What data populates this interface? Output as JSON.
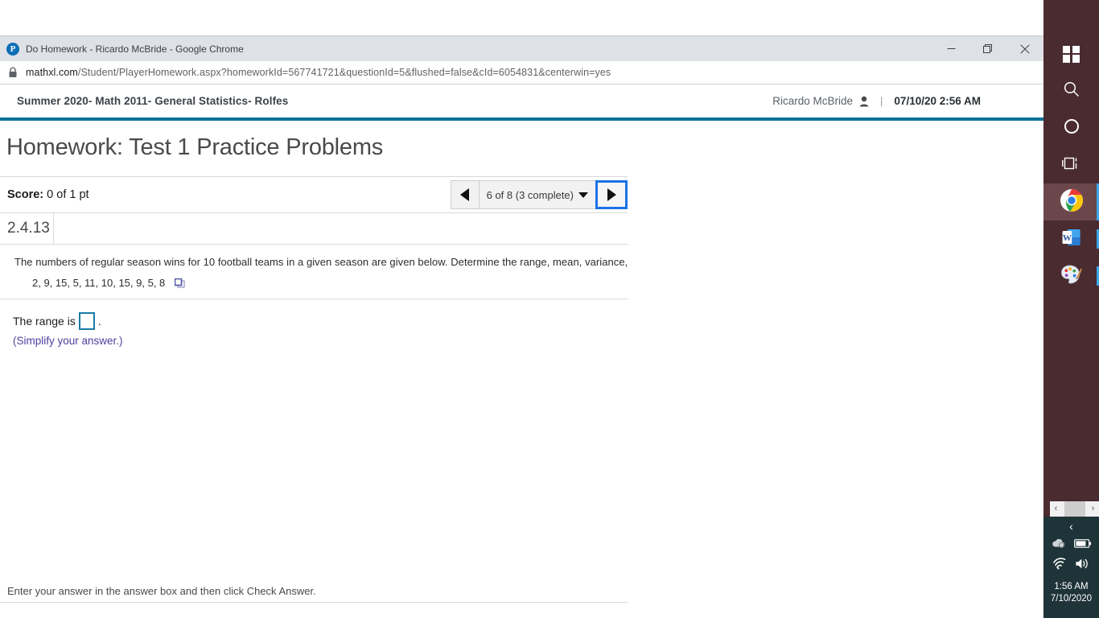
{
  "browser": {
    "tab_title": "Do Homework - Ricardo McBride - Google Chrome",
    "favicon_name": "pearson-p-icon",
    "url_host": "mathxl.com",
    "url_path": "/Student/PlayerHomework.aspx?homeworkId=567741721&questionId=5&flushed=false&cId=6054831&centerwin=yes",
    "minimize_label": "Minimize",
    "restore_label": "Restore",
    "close_label": "Close"
  },
  "course_header": {
    "course_title": "Summer 2020- Math 2011- General Statistics- Rolfes",
    "user_name": "Ricardo McBride",
    "separator": "|",
    "datetime": "07/10/20 2:56 AM",
    "accent_color": "#00739b"
  },
  "assignment": {
    "page_title": "Homework: Test 1 Practice Problems",
    "score_label": "Score:",
    "score_value": "0 of 1 pt",
    "nav": {
      "prev_label": "Previous question",
      "position_label": "6 of 8 (3 complete)",
      "next_label": "Next question",
      "focus_color": "#1a73e8"
    }
  },
  "question": {
    "number": "2.4.13",
    "prompt": "The numbers of regular season wins for 10 football teams in a given season are given below. Determine the range, mean, variance, and standard deviation of the population data set.",
    "data_values": "2, 9, 15, 5, 11, 10, 15, 9, 5, 8",
    "popout_icon_name": "open-in-new-window-icon",
    "answer_prefix": "The range is",
    "answer_suffix": ".",
    "answer_value": "",
    "simplify_note": "(Simplify your answer.)",
    "note_color": "#4b3f9e"
  },
  "footer": {
    "instruction": "Enter your answer in the answer box and then click Check Answer."
  },
  "taskbar": {
    "items": [
      {
        "name": "start-button",
        "label": "Start"
      },
      {
        "name": "search-icon",
        "label": "Search"
      },
      {
        "name": "cortana-icon",
        "label": "Cortana"
      },
      {
        "name": "task-view-icon",
        "label": "Task View"
      },
      {
        "name": "chrome-icon",
        "label": "Google Chrome"
      },
      {
        "name": "word-icon",
        "label": "Microsoft Word"
      },
      {
        "name": "paint-icon",
        "label": "Paint 3D"
      }
    ],
    "scroll": {
      "left_arrow": "‹",
      "right_arrow": "›"
    },
    "tray": {
      "chevron": "‹",
      "icons": [
        "onedrive-paused-icon",
        "battery-icon",
        "wifi-icon",
        "volume-icon"
      ],
      "time": "1:56 AM",
      "date": "7/10/2020"
    },
    "background_color": "#4a2b30",
    "tray_background_color": "#1f3439"
  }
}
